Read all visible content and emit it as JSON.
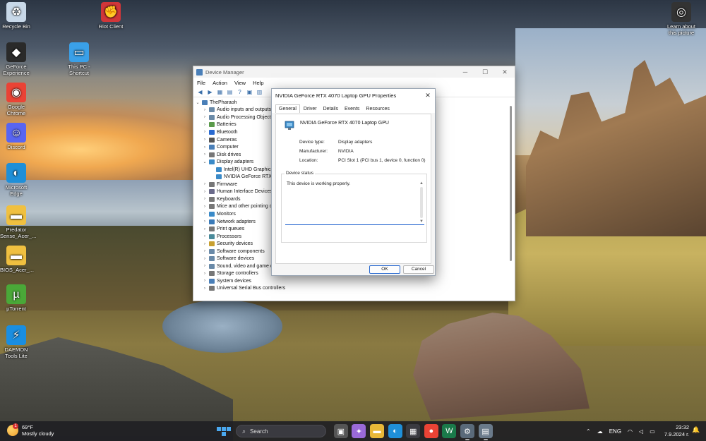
{
  "desktop": {
    "icons": [
      {
        "label": "Recycle Bin",
        "icon": "recycle-bin-icon",
        "color": "#c8d8e8"
      },
      {
        "label": "Riot Client",
        "icon": "riot-client-icon",
        "color": "#d13639"
      },
      {
        "label": "GeForce Experience",
        "icon": "geforce-experience-icon",
        "color": "#2a2a2a"
      },
      {
        "label": "This PC - Shortcut",
        "icon": "this-pc-icon",
        "color": "#3aa0e8"
      },
      {
        "label": "Google Chrome",
        "icon": "chrome-icon",
        "color": "#ea4335"
      },
      {
        "label": "Discord",
        "icon": "discord-icon",
        "color": "#5865f2"
      },
      {
        "label": "Microsoft Edge",
        "icon": "edge-icon",
        "color": "#1f8fd8"
      },
      {
        "label": "Predator Sense_Acer_...",
        "icon": "folder-icon",
        "color": "#f0c040"
      },
      {
        "label": "BIOS_Acer_...",
        "icon": "folder-icon",
        "color": "#f0c040"
      },
      {
        "label": "µTorrent",
        "icon": "utorrent-icon",
        "color": "#4aa838"
      },
      {
        "label": "DAEMON Tools Lite",
        "icon": "daemon-tools-icon",
        "color": "#1a8ee0"
      },
      {
        "label": "Learn about this picture",
        "icon": "learn-picture-icon",
        "color": "#333333"
      }
    ]
  },
  "device_manager": {
    "title": "Device Manager",
    "menu": [
      "File",
      "Action",
      "View",
      "Help"
    ],
    "tree": [
      {
        "label": "ThePharaoh",
        "level": 0,
        "expander": "⌄",
        "color": "#4a7fb8"
      },
      {
        "label": "Audio inputs and outputs",
        "level": 1,
        "expander": "›",
        "color": "#6a8aa8"
      },
      {
        "label": "Audio Processing Objects (APOs)",
        "level": 1,
        "expander": "›",
        "color": "#6a8aa8"
      },
      {
        "label": "Batteries",
        "level": 1,
        "expander": "›",
        "color": "#5a9a4a"
      },
      {
        "label": "Bluetooth",
        "level": 1,
        "expander": "›",
        "color": "#2a6ad0"
      },
      {
        "label": "Cameras",
        "level": 1,
        "expander": "›",
        "color": "#555555"
      },
      {
        "label": "Computer",
        "level": 1,
        "expander": "›",
        "color": "#4a7fb8"
      },
      {
        "label": "Disk drives",
        "level": 1,
        "expander": "›",
        "color": "#777777"
      },
      {
        "label": "Display adapters",
        "level": 1,
        "expander": "⌄",
        "color": "#3a8ac8"
      },
      {
        "label": "Intel(R) UHD Graphics",
        "level": 2,
        "expander": "",
        "color": "#3a8ac8"
      },
      {
        "label": "NVIDIA GeForce RTX 4070 Laptop GPU",
        "level": 2,
        "expander": "",
        "color": "#3a8ac8"
      },
      {
        "label": "Firmware",
        "level": 1,
        "expander": "›",
        "color": "#777777"
      },
      {
        "label": "Human Interface Devices",
        "level": 1,
        "expander": "›",
        "color": "#6a6a8a"
      },
      {
        "label": "Keyboards",
        "level": 1,
        "expander": "›",
        "color": "#777777"
      },
      {
        "label": "Mice and other pointing devices",
        "level": 1,
        "expander": "›",
        "color": "#777777"
      },
      {
        "label": "Monitors",
        "level": 1,
        "expander": "›",
        "color": "#3a8ac8"
      },
      {
        "label": "Network adapters",
        "level": 1,
        "expander": "›",
        "color": "#3a7ab8"
      },
      {
        "label": "Print queues",
        "level": 1,
        "expander": "›",
        "color": "#777777"
      },
      {
        "label": "Processors",
        "level": 1,
        "expander": "›",
        "color": "#4a8a9a"
      },
      {
        "label": "Security devices",
        "level": 1,
        "expander": "›",
        "color": "#c8a030"
      },
      {
        "label": "Software components",
        "level": 1,
        "expander": "›",
        "color": "#6a8aa8"
      },
      {
        "label": "Software devices",
        "level": 1,
        "expander": "›",
        "color": "#6a8aa8"
      },
      {
        "label": "Sound, video and game controllers",
        "level": 1,
        "expander": "›",
        "color": "#6a8aa8"
      },
      {
        "label": "Storage controllers",
        "level": 1,
        "expander": "›",
        "color": "#777777"
      },
      {
        "label": "System devices",
        "level": 1,
        "expander": "›",
        "color": "#4a7fb8"
      },
      {
        "label": "Universal Serial Bus controllers",
        "level": 1,
        "expander": "›",
        "color": "#777777"
      }
    ]
  },
  "properties": {
    "title": "NVIDIA GeForce RTX 4070 Laptop GPU Properties",
    "tabs": [
      "General",
      "Driver",
      "Details",
      "Events",
      "Resources"
    ],
    "active_tab": "General",
    "device_name": "NVIDIA GeForce RTX 4070 Laptop GPU",
    "fields": [
      {
        "label": "Device type:",
        "value": "Display adapters"
      },
      {
        "label": "Manufacturer:",
        "value": "NVIDIA"
      },
      {
        "label": "Location:",
        "value": "PCI Slot 1 (PCI bus 1, device 0, function 0)"
      }
    ],
    "status_group_label": "Device status",
    "status_text": "This device is working properly.",
    "ok_label": "OK",
    "cancel_label": "Cancel"
  },
  "taskbar": {
    "weather_temp": "69°F",
    "weather_cond": "Mostly cloudy",
    "weather_badge": "1",
    "search_label": "Search",
    "apps": [
      {
        "name": "task-view-icon",
        "glyph": "▣",
        "color": "#555555",
        "running": false
      },
      {
        "name": "copilot-icon",
        "glyph": "✦",
        "color": "#9a6ad8",
        "running": false
      },
      {
        "name": "file-explorer-icon",
        "glyph": "▬",
        "color": "#e8b838",
        "running": false
      },
      {
        "name": "edge-icon",
        "glyph": "◐",
        "color": "#1f8fd8",
        "running": false
      },
      {
        "name": "microsoft-store-icon",
        "glyph": "▦",
        "color": "#3a3a40",
        "running": false
      },
      {
        "name": "chrome-icon",
        "glyph": "●",
        "color": "#ea4335",
        "running": false
      },
      {
        "name": "w-app-icon",
        "glyph": "W",
        "color": "#1a7a4a",
        "running": false
      },
      {
        "name": "settings-gear-icon",
        "glyph": "⚙",
        "color": "#5a6a7a",
        "running": true
      },
      {
        "name": "device-manager-icon",
        "glyph": "▤",
        "color": "#6a7a8a",
        "running": true
      }
    ],
    "tray_chevron": "⌃",
    "tray_cloud": "☁",
    "language": "ENG",
    "tray_wifi": "◠",
    "tray_volume": "◁",
    "tray_battery": "▭",
    "time": "23:32",
    "date": "7.9.2024 г.",
    "bell": "🔔"
  }
}
